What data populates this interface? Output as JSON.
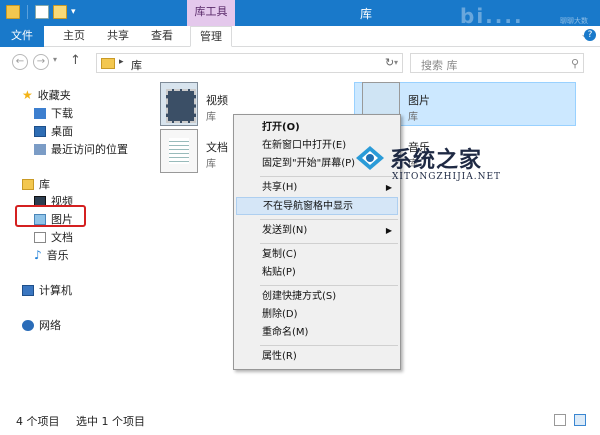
{
  "window": {
    "title": "库",
    "contextual_tab_group": "库工具",
    "brand_watermark": "bi....",
    "brand_watermark_small": "聊聊大数"
  },
  "ribbon": {
    "tabs": [
      {
        "label": "文件"
      },
      {
        "label": "主页"
      },
      {
        "label": "共享"
      },
      {
        "label": "查看"
      },
      {
        "label": "管理"
      }
    ],
    "help_label": "?"
  },
  "address": {
    "crumb": "库",
    "search_placeholder": "搜索 库"
  },
  "nav_pane": {
    "favorites": {
      "label": "收藏夹",
      "items": [
        "下载",
        "桌面",
        "最近访问的位置"
      ]
    },
    "libraries": {
      "label": "库",
      "items": [
        "视频",
        "图片",
        "文档",
        "音乐"
      ],
      "highlighted_item": "图片"
    },
    "computer": "计算机",
    "network": "网络"
  },
  "content": {
    "items": [
      {
        "name": "视频",
        "type": "库"
      },
      {
        "name": "图片",
        "type": "库",
        "selected": true
      },
      {
        "name": "文档",
        "type": "库"
      },
      {
        "name": "音乐",
        "type": "库"
      }
    ]
  },
  "context_menu": {
    "groups": [
      [
        {
          "label": "打开(O)",
          "bold": true
        },
        {
          "label": "在新窗口中打开(E)"
        },
        {
          "label": "固定到\"开始\"屏幕(P)"
        }
      ],
      [
        {
          "label": "共享(H)",
          "submenu": true
        },
        {
          "label": "不在导航窗格中显示",
          "highlighted": true
        }
      ],
      [
        {
          "label": "发送到(N)",
          "submenu": true
        }
      ],
      [
        {
          "label": "复制(C)"
        },
        {
          "label": "粘贴(P)"
        }
      ],
      [
        {
          "label": "创建快捷方式(S)"
        },
        {
          "label": "删除(D)"
        },
        {
          "label": "重命名(M)"
        }
      ],
      [
        {
          "label": "属性(R)"
        }
      ]
    ]
  },
  "watermark": {
    "title": "系统之家",
    "subtitle": "XITONGZHIJIA.NET"
  },
  "status_bar": {
    "item_count": "4 个项目",
    "selected_count": "选中 1 个项目"
  },
  "colors": {
    "accent": "#1979ca",
    "contextual_tab": "#e4c8ec",
    "selection": "#cce8ff",
    "highlight_box": "#d42020"
  }
}
